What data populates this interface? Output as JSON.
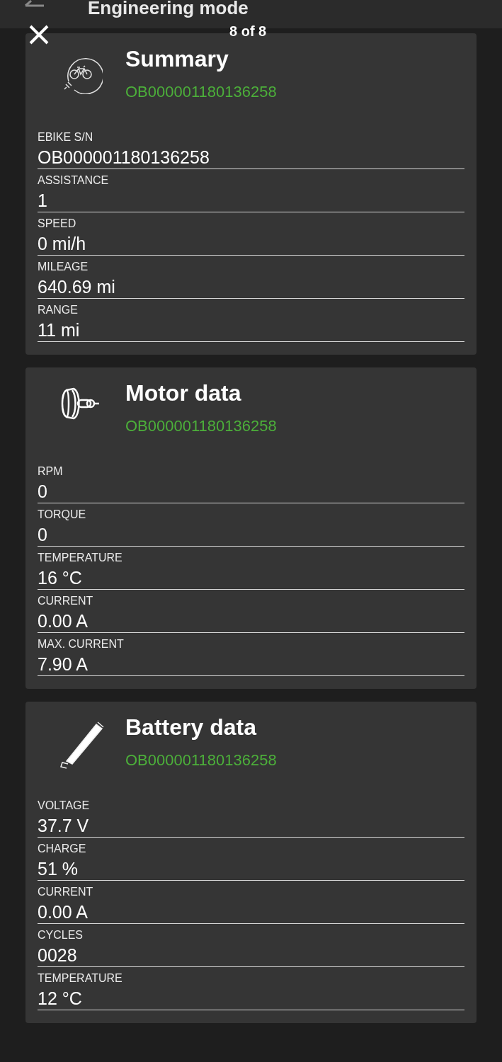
{
  "app_bar": {
    "title": "Engineering mode"
  },
  "viewer": {
    "counter": "8 of 8"
  },
  "cards": [
    {
      "kind": "summary",
      "title": "Summary",
      "serial": "OB000001180136258",
      "fields": [
        {
          "label": "EBIKE S/N",
          "value": "OB000001180136258"
        },
        {
          "label": "ASSISTANCE",
          "value": "1"
        },
        {
          "label": "SPEED",
          "value": "0 mi/h"
        },
        {
          "label": "MILEAGE",
          "value": "640.69 mi"
        },
        {
          "label": "RANGE",
          "value": "11 mi"
        }
      ]
    },
    {
      "kind": "motor",
      "title": "Motor data",
      "serial": "OB000001180136258",
      "fields": [
        {
          "label": "RPM",
          "value": "0"
        },
        {
          "label": "TORQUE",
          "value": "0"
        },
        {
          "label": "TEMPERATURE",
          "value": "16 °C"
        },
        {
          "label": "CURRENT",
          "value": "0.00 A"
        },
        {
          "label": "MAX. CURRENT",
          "value": "7.90 A"
        }
      ]
    },
    {
      "kind": "battery",
      "title": "Battery data",
      "serial": "OB000001180136258",
      "fields": [
        {
          "label": "VOLTAGE",
          "value": "37.7 V"
        },
        {
          "label": "CHARGE",
          "value": "51 %"
        },
        {
          "label": "CURRENT",
          "value": "0.00 A"
        },
        {
          "label": "CYCLES",
          "value": "0028"
        },
        {
          "label": "TEMPERATURE",
          "value": "12 °C"
        }
      ]
    }
  ]
}
